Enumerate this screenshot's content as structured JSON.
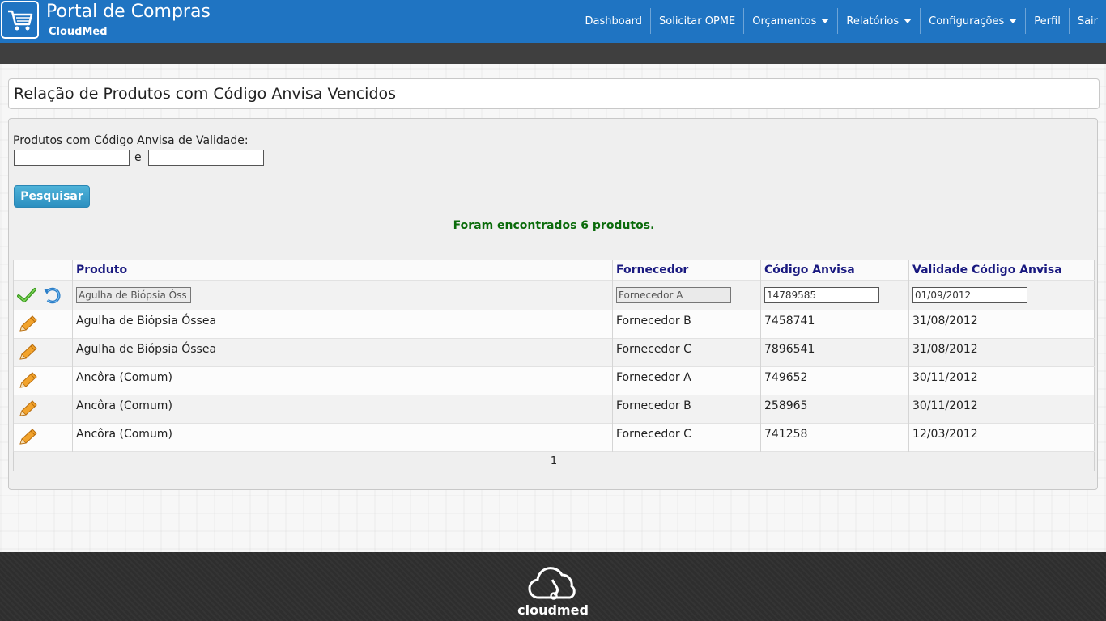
{
  "header": {
    "title": "Portal de Compras",
    "subtitle": "CloudMed",
    "logo_icon": "shopping-cart-icon",
    "nav": [
      {
        "label": "Dashboard",
        "dropdown": false
      },
      {
        "label": "Solicitar OPME",
        "dropdown": false
      },
      {
        "label": "Orçamentos",
        "dropdown": true
      },
      {
        "label": "Relatórios",
        "dropdown": true
      },
      {
        "label": "Configurações",
        "dropdown": true
      },
      {
        "label": "Perfil",
        "dropdown": false
      },
      {
        "label": "Sair",
        "dropdown": false
      }
    ],
    "colors": {
      "brand": "#1f74c2",
      "subbar": "#3f3f3f"
    }
  },
  "page": {
    "title": "Relação de Produtos com Código Anvisa Vencidos"
  },
  "filter": {
    "label": "Produtos com Código Anvisa de Validade:",
    "date_from": "",
    "conjunction": "e",
    "date_to": "",
    "search_button": "Pesquisar",
    "result_message": "Foram encontrados 6 produtos."
  },
  "table": {
    "columns": [
      "",
      "Produto",
      "Fornecedor",
      "Código Anvisa",
      "Validade Código Anvisa"
    ],
    "edit_row": {
      "produto": "Agulha de Biópsia Óss",
      "fornecedor": "Fornecedor A",
      "codigo": "14789585",
      "validade": "01/09/2012",
      "confirm_icon": "checkmark-icon",
      "undo_icon": "undo-icon"
    },
    "rows": [
      {
        "produto": "Agulha de Biópsia Óssea",
        "fornecedor": "Fornecedor B",
        "codigo": "7458741",
        "validade": "31/08/2012"
      },
      {
        "produto": "Agulha de Biópsia Óssea",
        "fornecedor": "Fornecedor C",
        "codigo": "7896541",
        "validade": "31/08/2012"
      },
      {
        "produto": "Ancôra (Comum)",
        "fornecedor": "Fornecedor A",
        "codigo": "749652",
        "validade": "30/11/2012"
      },
      {
        "produto": "Ancôra (Comum)",
        "fornecedor": "Fornecedor B",
        "codigo": "258965",
        "validade": "30/11/2012"
      },
      {
        "produto": "Ancôra (Comum)",
        "fornecedor": "Fornecedor C",
        "codigo": "741258",
        "validade": "12/03/2012"
      }
    ],
    "row_icon": "pencil-icon",
    "pager": "1"
  },
  "footer": {
    "logo_text": "cloudmed",
    "logo_icon": "cloud-stethoscope-icon"
  }
}
